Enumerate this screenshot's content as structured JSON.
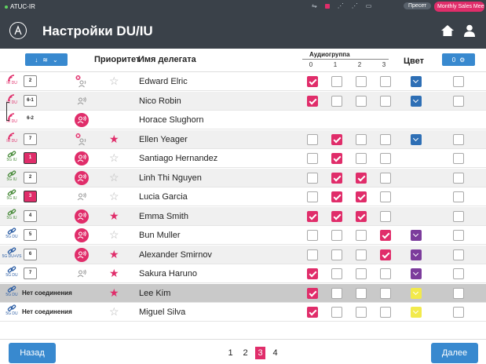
{
  "status_bar": {
    "system_name": "ATUC-IR",
    "preset_label": "Пресет",
    "meeting_label": "Monthly Sales Meeting ▾"
  },
  "header": {
    "title": "Настройки DU/IU"
  },
  "columns": {
    "priority": "Приоритет",
    "name": "Имя делегата",
    "audio_group": "Аудиогруппа",
    "groups": [
      "0",
      "1",
      "2",
      "3"
    ],
    "color": "Цвет",
    "count_label": "0"
  },
  "colors": {
    "accent": "#e02d6a",
    "button_blue": "#3889cf",
    "header_bg": "#3a4149",
    "color_blue": "#2e6fb5",
    "color_purple": "#7c3c9c",
    "color_yellow": "#f2ea4c"
  },
  "rows": [
    {
      "mic": "ir",
      "mic_label": "IR DU",
      "seat": "2",
      "speak": "muted",
      "star": false,
      "name": "Edward Elric",
      "groups": [
        true,
        false,
        false,
        false
      ],
      "color": "blue",
      "enabled": false
    },
    {
      "mic": "ir",
      "mic_label": "IR DU",
      "seat": "6-1",
      "speak": "off",
      "star": null,
      "name": "Nico Robin",
      "groups": [
        true,
        false,
        false,
        false
      ],
      "color": "blue",
      "enabled": false
    },
    {
      "mic": "ir",
      "mic_label": "IR DU",
      "seat": "6-2",
      "speak": "on",
      "star": null,
      "name": "Horace Slughorn",
      "groups": null,
      "color": null,
      "enabled": null
    },
    {
      "mic": "ir",
      "mic_label": "IR DU",
      "seat": "7",
      "speak": "muted",
      "star": true,
      "name": "Ellen Yeager",
      "groups": [
        false,
        true,
        false,
        false
      ],
      "color": "blue",
      "enabled": false
    },
    {
      "mic": "link",
      "mic_label": "5G IU",
      "seat": "1",
      "seat_active": true,
      "speak": "on",
      "star": false,
      "name": "Santiago Hernandez",
      "groups": [
        false,
        true,
        false,
        false
      ],
      "color": null,
      "enabled": false
    },
    {
      "mic": "link",
      "mic_label": "5G IU",
      "seat": "2",
      "speak": "on",
      "star": false,
      "name": "Linh Thi Nguyen",
      "groups": [
        false,
        true,
        true,
        false
      ],
      "color": null,
      "enabled": false
    },
    {
      "mic": "link",
      "mic_label": "5G IU",
      "seat": "3",
      "seat_active": true,
      "speak": "off",
      "star": false,
      "name": "Lucia Garcia",
      "groups": [
        false,
        true,
        true,
        false
      ],
      "color": null,
      "enabled": false
    },
    {
      "mic": "link",
      "mic_label": "5G IU",
      "seat": "4",
      "speak": "on",
      "star": true,
      "name": "Emma Smith",
      "groups": [
        true,
        true,
        true,
        false
      ],
      "color": null,
      "enabled": false
    },
    {
      "mic": "link2",
      "mic_label": "5G DU",
      "seat": "5",
      "speak": "on",
      "star": false,
      "name": "Bun Muller",
      "groups": [
        false,
        false,
        false,
        true
      ],
      "color": "purple",
      "enabled": false
    },
    {
      "mic": "link2",
      "mic_label": "5G DU+VS",
      "seat": "6",
      "speak": "on",
      "star": true,
      "name": "Alexander Smirnov",
      "groups": [
        false,
        false,
        false,
        true
      ],
      "color": "purple",
      "enabled": false
    },
    {
      "mic": "link2",
      "mic_label": "5G DU",
      "seat": "7",
      "speak": "off",
      "star": true,
      "name": "Sakura Haruno",
      "groups": [
        true,
        false,
        false,
        false
      ],
      "color": "purple",
      "enabled": false
    },
    {
      "mic": "link2",
      "mic_label": "5G DU",
      "no_connection": "Нет соединения",
      "speak": "none",
      "star": true,
      "name": "Lee Kim",
      "groups": [
        true,
        false,
        false,
        false
      ],
      "color": "yellow",
      "enabled": false,
      "disconnected": true
    },
    {
      "mic": "link2",
      "mic_label": "5G DU",
      "no_connection": "Нет соединения",
      "speak": "none",
      "star": false,
      "name": "Miguel Silva",
      "groups": [
        true,
        false,
        false,
        false
      ],
      "color": "yellow",
      "enabled": false
    }
  ],
  "pagination": {
    "pages": [
      "1",
      "2",
      "3",
      "4"
    ],
    "current": "3"
  },
  "footer": {
    "back_label": "Назад",
    "next_label": "Далее"
  }
}
